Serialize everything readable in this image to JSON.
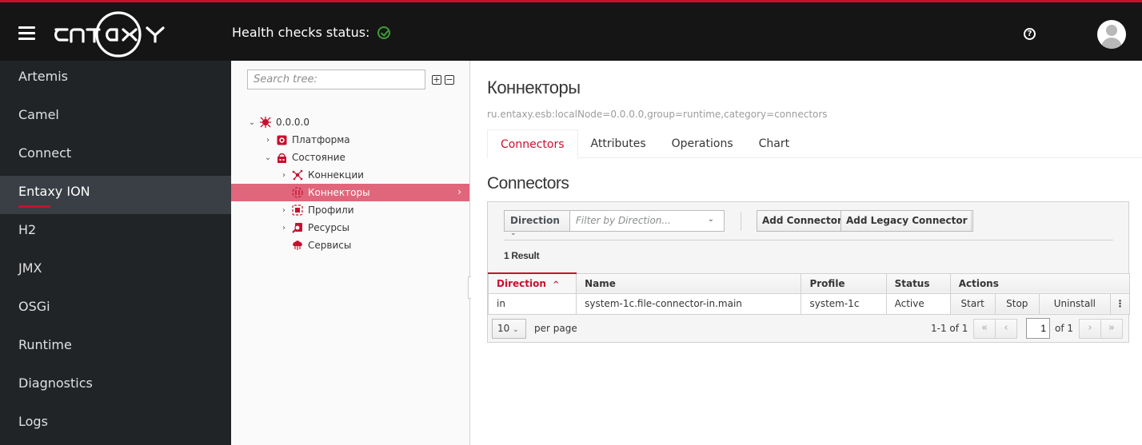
{
  "header": {
    "brand": "entaxy",
    "health_label": "Health checks status:",
    "health_status": "ok",
    "accent_color": "#c8102e",
    "help_glyph": "?"
  },
  "sidebar": {
    "items": [
      {
        "label": "Artemis"
      },
      {
        "label": "Camel"
      },
      {
        "label": "Connect"
      },
      {
        "label": "Entaxy ION",
        "active": true
      },
      {
        "label": "H2"
      },
      {
        "label": "JMX"
      },
      {
        "label": "OSGi"
      },
      {
        "label": "Runtime"
      },
      {
        "label": "Diagnostics"
      },
      {
        "label": "Logs"
      }
    ]
  },
  "tree": {
    "search_placeholder": "Search tree:",
    "expand_all": "+",
    "collapse_all": "−",
    "nodes": [
      {
        "label": "0.0.0.0",
        "toggle": "expanded",
        "level": 0,
        "icon": "node-icon"
      },
      {
        "label": "Платформа",
        "toggle": "collapsed",
        "level": 1,
        "icon": "platform-icon"
      },
      {
        "label": "Состояние",
        "toggle": "expanded",
        "level": 1,
        "icon": "state-icon"
      },
      {
        "label": "Коннекции",
        "toggle": "collapsed",
        "level": 2,
        "icon": "connections-icon"
      },
      {
        "label": "Коннекторы",
        "toggle": "none",
        "level": 2,
        "icon": "connectors-icon",
        "selected": true
      },
      {
        "label": "Профили",
        "toggle": "collapsed",
        "level": 2,
        "icon": "profiles-icon"
      },
      {
        "label": "Ресурсы",
        "toggle": "collapsed",
        "level": 2,
        "icon": "resources-icon"
      },
      {
        "label": "Сервисы",
        "toggle": "none",
        "level": 2,
        "icon": "services-icon"
      }
    ]
  },
  "main": {
    "title": "Коннекторы",
    "object_name": "ru.entaxy.esb:localNode=0.0.0.0,group=runtime,category=connectors",
    "tabs": [
      {
        "label": "Connectors",
        "active": true
      },
      {
        "label": "Attributes"
      },
      {
        "label": "Operations"
      },
      {
        "label": "Chart"
      }
    ],
    "section_title": "Connectors",
    "toolbar": {
      "filter_field": "Direction",
      "filter_placeholder": "Filter by Direction...",
      "add_connector": "Add Connector",
      "add_legacy_connector": "Add Legacy Connector"
    },
    "results": "1 Result",
    "table": {
      "columns": [
        "Direction",
        "Name",
        "Profile",
        "Status",
        "Actions"
      ],
      "sorted_column": "Direction",
      "sort_glyph": "^",
      "rows": [
        {
          "direction": "in",
          "name": "system-1c.file-connector-in.main",
          "profile": "system-1c",
          "status": "Active",
          "actions": [
            "Start",
            "Stop",
            "Uninstall"
          ]
        }
      ]
    },
    "pagination": {
      "per_page_value": "10",
      "per_page_label": "per page",
      "range": "1-1 of 1",
      "current_page": "1",
      "of_pages": "of 1",
      "first": "«",
      "prev": "‹",
      "next": "›",
      "last": "»"
    }
  }
}
